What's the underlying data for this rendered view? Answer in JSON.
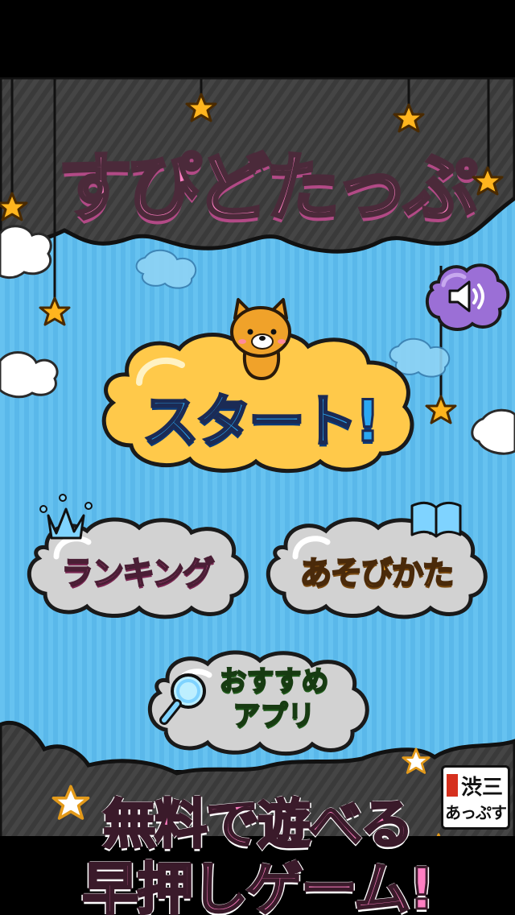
{
  "app": {
    "logo_title": "すぴどたっぷ"
  },
  "menu": {
    "start_label": "スタート!",
    "ranking_label": "ランキング",
    "howto_label": "あそびかた",
    "recommended_line1": "おすすめ",
    "recommended_line2": "アプリ"
  },
  "footer": {
    "line1": "無料で遊べる",
    "line2": "早押しゲーム!"
  },
  "brand": {
    "line1": "渋三",
    "line2": "あっぷす"
  },
  "icons": {
    "sound": "speaker-icon",
    "ranking": "crown-icon",
    "howto": "book-icon",
    "recommended": "magnifier-icon",
    "mascot": "bear-mascot"
  },
  "colors": {
    "sky": "#66c2f0",
    "night": "#3d3d3d",
    "start_cloud": "#ffc94a",
    "gray_cloud": "#d2d2d2",
    "sound_cloud": "#9b6fd6",
    "logo_pink": "#ff7fc2",
    "star": "#ffb51e"
  }
}
